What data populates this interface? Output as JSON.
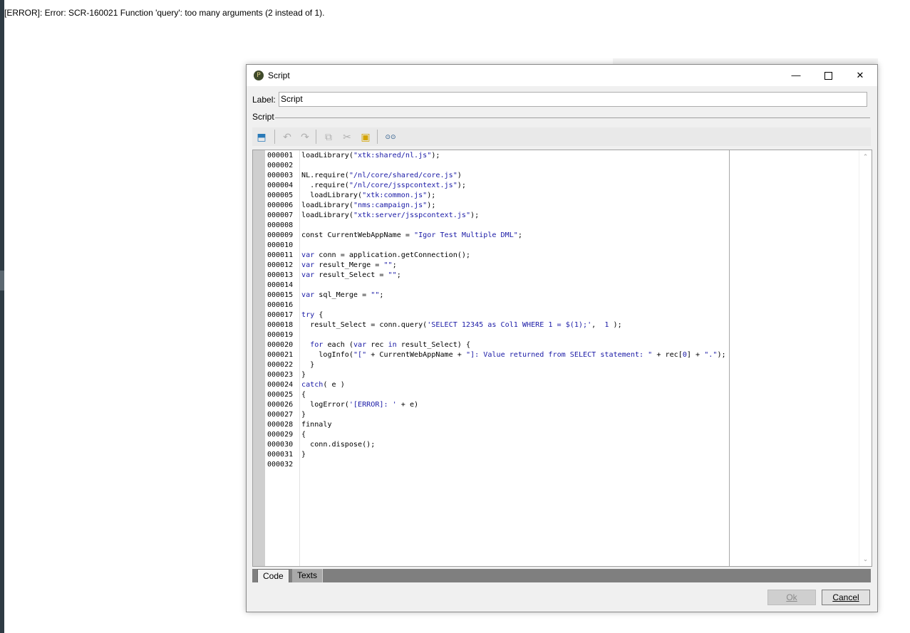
{
  "background": {
    "error_text": "[ERROR]: Error: SCR-160021 Function 'query': too many arguments (2 instead of 1)."
  },
  "dialog": {
    "title": "Script",
    "app_icon_glyph": "P",
    "label_caption": "Label:",
    "label_value": "Script",
    "section_title": "Script",
    "toolbar": [
      {
        "name": "insert-icon",
        "glyph": "⬒",
        "color": "#2a7ab8"
      },
      {
        "name": "undo-icon",
        "glyph": "↶",
        "color": "#b0b0b0"
      },
      {
        "name": "redo-icon",
        "glyph": "↷",
        "color": "#b0b0b0"
      },
      {
        "name": "copy-icon",
        "glyph": "⧉",
        "color": "#b0b0b0"
      },
      {
        "name": "cut-icon",
        "glyph": "✂",
        "color": "#b0b0b0"
      },
      {
        "name": "paste-icon",
        "glyph": "▣",
        "color": "#d4a400"
      },
      {
        "name": "find-icon",
        "glyph": "⊙⊙",
        "color": "#2a5a8a"
      }
    ],
    "line_numbers": [
      "000001",
      "000002",
      "000003",
      "000004",
      "000005",
      "000006",
      "000007",
      "000008",
      "000009",
      "000010",
      "000011",
      "000012",
      "000013",
      "000014",
      "000015",
      "000016",
      "000017",
      "000018",
      "000019",
      "000020",
      "000021",
      "000022",
      "000023",
      "000024",
      "000025",
      "000026",
      "000027",
      "000028",
      "000029",
      "000030",
      "000031",
      "000032"
    ],
    "code": [
      [
        [
          "t",
          "loadLibrary("
        ],
        [
          "s",
          "\"xtk:shared/nl.js\""
        ],
        [
          "t",
          ");"
        ]
      ],
      [],
      [
        [
          "t",
          "NL.require("
        ],
        [
          "s",
          "\"/nl/core/shared/core.js\""
        ],
        [
          "t",
          ")"
        ]
      ],
      [
        [
          "t",
          "  .require("
        ],
        [
          "s",
          "\"/nl/core/jsspcontext.js\""
        ],
        [
          "t",
          ");"
        ]
      ],
      [
        [
          "t",
          "  loadLibrary("
        ],
        [
          "s",
          "\"xtk:common.js\""
        ],
        [
          "t",
          ");"
        ]
      ],
      [
        [
          "t",
          "loadLibrary("
        ],
        [
          "s",
          "\"nms:campaign.js\""
        ],
        [
          "t",
          ");"
        ]
      ],
      [
        [
          "t",
          "loadLibrary("
        ],
        [
          "s",
          "\"xtk:server/jsspcontext.js\""
        ],
        [
          "t",
          ");"
        ]
      ],
      [],
      [
        [
          "t",
          "const CurrentWebAppName = "
        ],
        [
          "s",
          "\"Igor Test Multiple DML\""
        ],
        [
          "t",
          ";"
        ]
      ],
      [],
      [
        [
          "k",
          "var"
        ],
        [
          "t",
          " conn = application.getConnection();"
        ]
      ],
      [
        [
          "k",
          "var"
        ],
        [
          "t",
          " result_Merge = "
        ],
        [
          "s",
          "\"\""
        ],
        [
          "t",
          ";"
        ]
      ],
      [
        [
          "k",
          "var"
        ],
        [
          "t",
          " result_Select = "
        ],
        [
          "s",
          "\"\""
        ],
        [
          "t",
          ";"
        ]
      ],
      [],
      [
        [
          "k",
          "var"
        ],
        [
          "t",
          " sql_Merge = "
        ],
        [
          "s",
          "\"\""
        ],
        [
          "t",
          ";"
        ]
      ],
      [],
      [
        [
          "k",
          "try"
        ],
        [
          "t",
          " {"
        ]
      ],
      [
        [
          "t",
          "  result_Select = conn.query("
        ],
        [
          "s",
          "'SELECT 12345 as Col1 WHERE 1 = $(1);'"
        ],
        [
          "t",
          ",  "
        ],
        [
          "s",
          "1"
        ],
        [
          "t",
          " );"
        ]
      ],
      [],
      [
        [
          "t",
          "  "
        ],
        [
          "k",
          "for"
        ],
        [
          "t",
          " each ("
        ],
        [
          "k",
          "var"
        ],
        [
          "t",
          " rec "
        ],
        [
          "k",
          "in"
        ],
        [
          "t",
          " result_Select) {"
        ]
      ],
      [
        [
          "t",
          "    logInfo("
        ],
        [
          "s",
          "\"[\""
        ],
        [
          "t",
          " + CurrentWebAppName + "
        ],
        [
          "s",
          "\"]: Value returned from SELECT statement: \""
        ],
        [
          "t",
          " + rec["
        ],
        [
          "s",
          "0"
        ],
        [
          "t",
          "] + "
        ],
        [
          "s",
          "\".\""
        ],
        [
          "t",
          ");"
        ]
      ],
      [
        [
          "t",
          "  }"
        ]
      ],
      [
        [
          "t",
          "}"
        ]
      ],
      [
        [
          "k",
          "catch"
        ],
        [
          "t",
          "( e )"
        ]
      ],
      [
        [
          "t",
          "{"
        ]
      ],
      [
        [
          "t",
          "  logError("
        ],
        [
          "s",
          "'[ERROR]: '"
        ],
        [
          "t",
          " + e)"
        ]
      ],
      [
        [
          "t",
          "}"
        ]
      ],
      [
        [
          "t",
          "finnaly"
        ]
      ],
      [
        [
          "t",
          "{"
        ]
      ],
      [
        [
          "t",
          "  conn.dispose();"
        ]
      ],
      [
        [
          "t",
          "}"
        ]
      ],
      []
    ],
    "tabs": {
      "code": "Code",
      "texts": "Texts"
    },
    "buttons": {
      "ok": "Ok",
      "cancel": "Cancel"
    },
    "colors": {
      "keyword": "#1a1aa6",
      "string": "#1a1aa6",
      "line_number": "#000000"
    }
  }
}
